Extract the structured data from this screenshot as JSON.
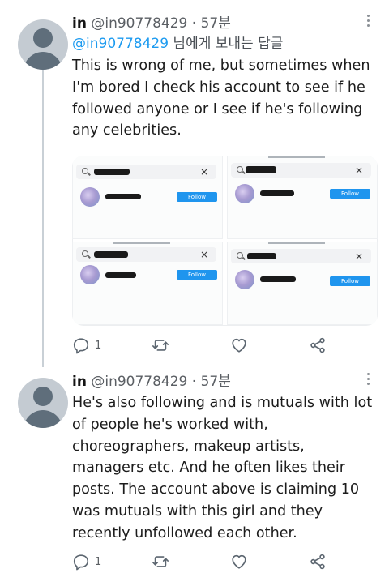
{
  "tweet1": {
    "name": "in",
    "handle": "@in90778429",
    "dot": "·",
    "time": "57분",
    "reply_mention": "@in90778429",
    "reply_suffix": " 님에게 보내는 답글",
    "text": "This is wrong of me, but sometimes when I'm bored I check his account to see if he followed anyone or I see if he's following any celebrities.",
    "media": {
      "follow_label": "Follow",
      "close_glyph": "×"
    },
    "reply_count": "1"
  },
  "tweet2": {
    "name": "in",
    "handle": "@in90778429",
    "dot": "·",
    "time": "57분",
    "text": "He's also following and is mutuals with lot of people he's worked with, choreographers, makeup artists, managers etc. And he often likes their posts. The account above is claiming 10 was mutuals with this girl and they recently unfollowed each other.",
    "reply_count": "1"
  },
  "icons": {
    "more": "more-vertical-icon",
    "reply": "reply-icon",
    "retweet": "retweet-icon",
    "like": "heart-icon",
    "share": "share-icon",
    "search": "search-icon",
    "close": "close-icon"
  },
  "colors": {
    "accent": "#1d9bf0",
    "follow_button": "#1f95ee",
    "avatar_bg": "#c4cbd2",
    "avatar_fg": "#5f6e7b",
    "muted_text": "#5b5f64",
    "icon": "#5c6670"
  }
}
